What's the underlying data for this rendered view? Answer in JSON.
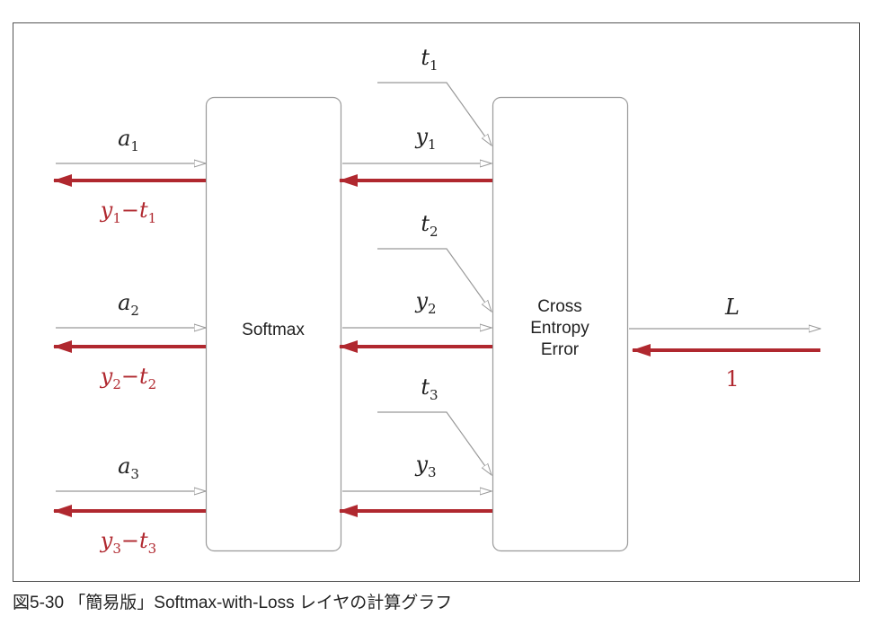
{
  "nodes": {
    "softmax": "Softmax",
    "cross_entropy": [
      "Cross",
      "Entropy",
      "Error"
    ]
  },
  "inputs": [
    {
      "base": "a",
      "sub": "1"
    },
    {
      "base": "a",
      "sub": "2"
    },
    {
      "base": "a",
      "sub": "3"
    }
  ],
  "softmax_outputs": [
    {
      "base": "y",
      "sub": "1"
    },
    {
      "base": "y",
      "sub": "2"
    },
    {
      "base": "y",
      "sub": "3"
    }
  ],
  "targets": [
    {
      "base": "t",
      "sub": "1"
    },
    {
      "base": "t",
      "sub": "2"
    },
    {
      "base": "t",
      "sub": "3"
    }
  ],
  "gradients": [
    {
      "y": "y",
      "ysub": "1",
      "op": "−",
      "t": "t",
      "tsub": "1"
    },
    {
      "y": "y",
      "ysub": "2",
      "op": "−",
      "t": "t",
      "tsub": "2"
    },
    {
      "y": "y",
      "ysub": "3",
      "op": "−",
      "t": "t",
      "tsub": "3"
    }
  ],
  "loss": {
    "label": "L",
    "grad": "1"
  },
  "caption": "図5-30 「簡易版」Softmax-with-Loss レイヤの計算グラフ",
  "colors": {
    "forward": "#999999",
    "backward": "#b0282f",
    "frame": "#555555",
    "box": "#999999"
  }
}
